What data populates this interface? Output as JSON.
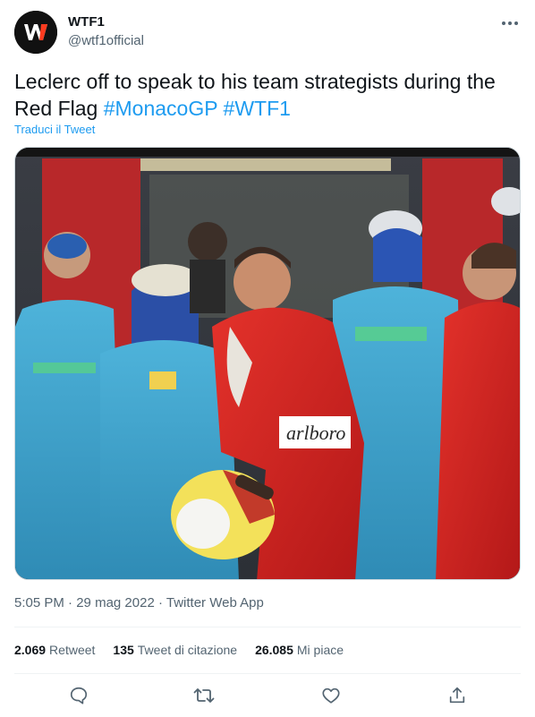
{
  "author": {
    "name": "WTF1",
    "handle": "@wtf1official",
    "avatar_icon": "wtf1-logo-icon"
  },
  "tweet": {
    "text_plain": "Leclerc off to speak to his team strategists during the Red Flag ",
    "hashtags": [
      "#MonacoGP",
      "#WTF1"
    ],
    "translate_label": "Traduci il Tweet"
  },
  "media": {
    "type": "photo"
  },
  "meta": {
    "time": "5:05 PM",
    "date": "29 mag 2022",
    "source": "Twitter Web App",
    "separator": "·"
  },
  "stats": {
    "retweets_count": "2.069",
    "retweets_label": "Retweet",
    "quotes_count": "135",
    "quotes_label": "Tweet di citazione",
    "likes_count": "26.085",
    "likes_label": "Mi piace"
  },
  "actions": [
    "reply-icon",
    "retweet-icon",
    "like-icon",
    "share-icon"
  ],
  "colors": {
    "link": "#1d9bf0",
    "secondary_text": "#536471",
    "primary_text": "#0f1419",
    "ferrari_red": "#d41f1f",
    "benetton_blue": "#3ea2cc"
  }
}
